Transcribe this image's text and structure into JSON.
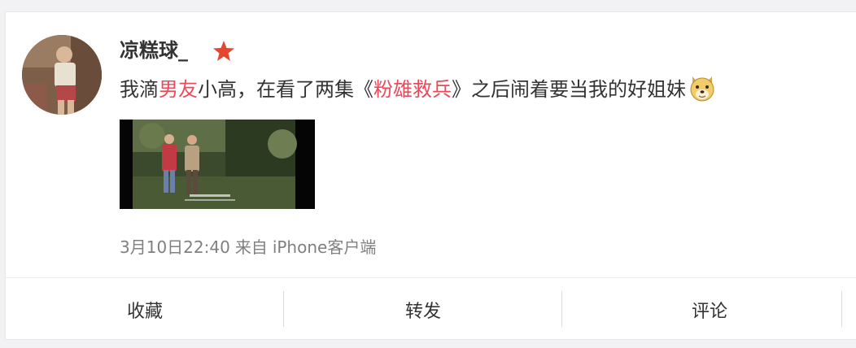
{
  "post": {
    "username": "凉糕球_",
    "text_segments": [
      {
        "text": "我滴",
        "highlight": false
      },
      {
        "text": "男友",
        "highlight": true
      },
      {
        "text": "小高，在看了两集《",
        "highlight": false
      },
      {
        "text": "粉雄救兵",
        "highlight": true
      },
      {
        "text": "》之后闹着要当我的好姐妹",
        "highlight": false
      }
    ],
    "emoji": "doge-emoji",
    "timestamp": "3月10日22:40",
    "source_prefix": "来自",
    "source": "iPhone客户端"
  },
  "actions": {
    "favorite": "收藏",
    "repost": "转发",
    "comment": "评论"
  },
  "colors": {
    "highlight": "#eb4a5a",
    "star": "#e6452f",
    "text": "#333333",
    "meta": "#808080"
  },
  "icons": {
    "vip": "star-icon",
    "emoji": "doge-emoji-icon"
  }
}
